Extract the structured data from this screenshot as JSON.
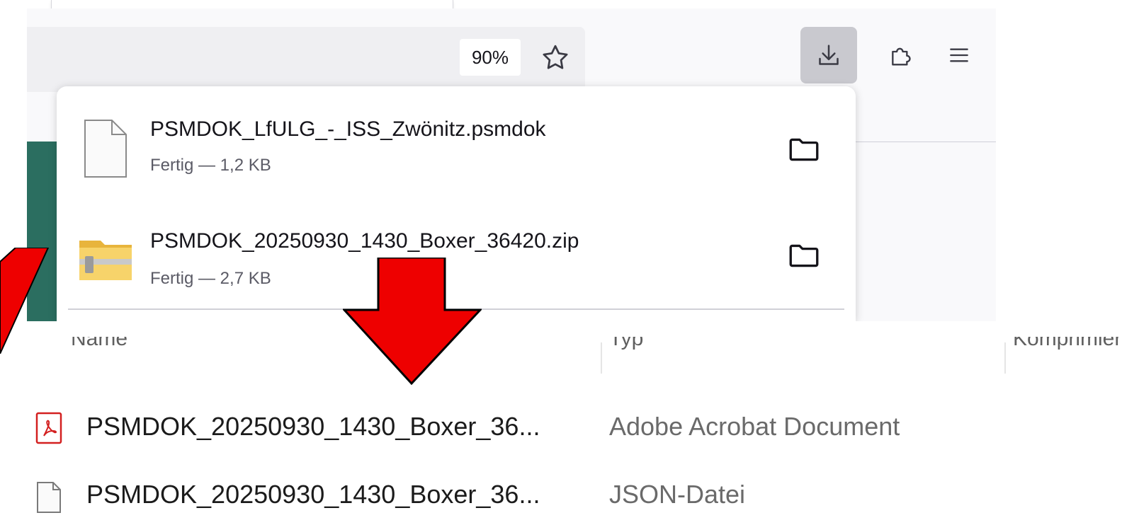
{
  "browser": {
    "zoom_level": "90%",
    "toolbar_buttons": [
      "bookmark-star-icon",
      "download-icon",
      "extensions-icon",
      "menu-icon"
    ]
  },
  "downloads": {
    "items": [
      {
        "file_name": "PSMDOK_LfULG_-_ISS_Zwönitz.psmdok",
        "status": "Fertig — 1,2 KB",
        "icon": "generic-file-icon"
      },
      {
        "file_name": "PSMDOK_20250930_1430_Boxer_36420.zip",
        "status": "Fertig — 2,7 KB",
        "icon": "zip-folder-icon"
      }
    ]
  },
  "explorer": {
    "columns": [
      "Name",
      "Typ",
      "Komprimierte Größe"
    ],
    "rows": [
      {
        "name": "PSMDOK_20250930_1430_Boxer_36...",
        "type": "Adobe Acrobat Document",
        "icon": "pdf-icon"
      },
      {
        "name": "PSMDOK_20250930_1430_Boxer_36...",
        "type": "JSON-Datei",
        "icon": "generic-file-icon"
      }
    ]
  },
  "colors": {
    "arrow": "#ee0000",
    "accent_strip": "#2b6e60",
    "active_button": "#c9c9cf"
  }
}
